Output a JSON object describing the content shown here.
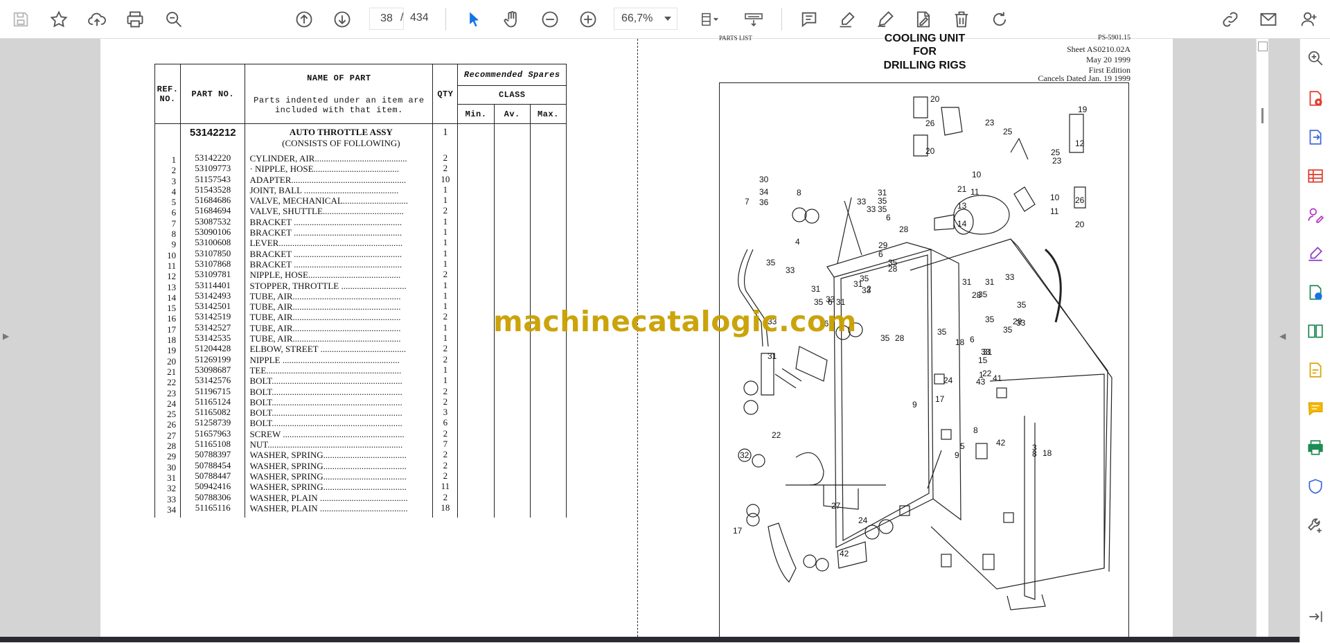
{
  "toolbar": {
    "current_page": "38",
    "page_separator": "/",
    "total_pages": "434",
    "zoom": "66,7%"
  },
  "left_page": {
    "table_headers": {
      "ref": "REF. NO.",
      "part_no": "PART NO.",
      "name": "NAME OF PART",
      "name_note": "Parts indented under an item are included with that item.",
      "qty": "QTY",
      "spares_title": "Recommended Spares",
      "class": "CLASS",
      "min": "Min.",
      "av": "Av.",
      "max": "Max."
    },
    "assembly": {
      "part_no": "53142212",
      "name": "AUTO THROTTLE ASSY",
      "subtitle": "(CONSISTS OF FOLLOWING)",
      "qty": "1"
    },
    "rows": [
      {
        "ref": "1",
        "part": "53142220",
        "name": "CYLINDER, AIR.........................................",
        "qty": "2"
      },
      {
        "ref": "2",
        "part": "53109773",
        "name": "· NIPPLE, HOSE......................................",
        "qty": "2"
      },
      {
        "ref": "3",
        "part": "51157543",
        "name": "ADAPTER...................................................",
        "qty": "10"
      },
      {
        "ref": "4",
        "part": "51543528",
        "name": "JOINT, BALL ..........................................",
        "qty": "1"
      },
      {
        "ref": "5",
        "part": "51684686",
        "name": "VALVE, MECHANICAL.............................",
        "qty": "1"
      },
      {
        "ref": "6",
        "part": "51684694",
        "name": "VALVE, SHUTTLE....................................",
        "qty": "2"
      },
      {
        "ref": "7",
        "part": "53087532",
        "name": "BRACKET ................................................",
        "qty": "1"
      },
      {
        "ref": "8",
        "part": "53090106",
        "name": "BRACKET ................................................",
        "qty": "1"
      },
      {
        "ref": "9",
        "part": "53100608",
        "name": "LEVER.......................................................",
        "qty": "1"
      },
      {
        "ref": "10",
        "part": "53107850",
        "name": "BRACKET ................................................",
        "qty": "1"
      },
      {
        "ref": "11",
        "part": "53107868",
        "name": "BRACKET ................................................",
        "qty": "1"
      },
      {
        "ref": "12",
        "part": "53109781",
        "name": "NIPPLE, HOSE.........................................",
        "qty": "2"
      },
      {
        "ref": "13",
        "part": "53114401",
        "name": "STOPPER, THROTTLE .............................",
        "qty": "1"
      },
      {
        "ref": "14",
        "part": "53142493",
        "name": "TUBE, AIR................................................",
        "qty": "1"
      },
      {
        "ref": "15",
        "part": "53142501",
        "name": "TUBE, AIR................................................",
        "qty": "1"
      },
      {
        "ref": "16",
        "part": "53142519",
        "name": "TUBE, AIR................................................",
        "qty": "2"
      },
      {
        "ref": "17",
        "part": "53142527",
        "name": "TUBE, AIR................................................",
        "qty": "1"
      },
      {
        "ref": "18",
        "part": "53142535",
        "name": "TUBE, AIR................................................",
        "qty": "1"
      },
      {
        "ref": "19",
        "part": "51204428",
        "name": "ELBOW, STREET ......................................",
        "qty": "2"
      },
      {
        "ref": "20",
        "part": "51269199",
        "name": "NIPPLE ....................................................",
        "qty": "2"
      },
      {
        "ref": "21",
        "part": "53098687",
        "name": "TEE............................................................",
        "qty": "1"
      },
      {
        "ref": "22",
        "part": "53142576",
        "name": "BOLT..........................................................",
        "qty": "1"
      },
      {
        "ref": "23",
        "part": "51196715",
        "name": "BOLT..........................................................",
        "qty": "2"
      },
      {
        "ref": "24",
        "part": "51165124",
        "name": "BOLT..........................................................",
        "qty": "2"
      },
      {
        "ref": "25",
        "part": "51165082",
        "name": "BOLT..........................................................",
        "qty": "3"
      },
      {
        "ref": "26",
        "part": "51258739",
        "name": "BOLT..........................................................",
        "qty": "6"
      },
      {
        "ref": "27",
        "part": "51657963",
        "name": "SCREW ......................................................",
        "qty": "2"
      },
      {
        "ref": "28",
        "part": "51165108",
        "name": "NUT............................................................",
        "qty": "7"
      },
      {
        "ref": "29",
        "part": "50788397",
        "name": "WASHER, SPRING.....................................",
        "qty": "2"
      },
      {
        "ref": "30",
        "part": "50788454",
        "name": "WASHER, SPRING.....................................",
        "qty": "2"
      },
      {
        "ref": "31",
        "part": "50788447",
        "name": "WASHER, SPRING.....................................",
        "qty": "2"
      },
      {
        "ref": "32",
        "part": "50942416",
        "name": "WASHER, SPRING.....................................",
        "qty": "11"
      },
      {
        "ref": "33",
        "part": "50788306",
        "name": "WASHER, PLAIN .......................................",
        "qty": "2"
      },
      {
        "ref": "34",
        "part": "51165116",
        "name": "WASHER, PLAIN .......................................",
        "qty": "18"
      }
    ]
  },
  "right_page": {
    "header_left": "PARTS LIST",
    "header_code": "PS-5901.15",
    "sheet": "Sheet AS0210.02A",
    "date": "May 20 1999",
    "edition": "First Edition",
    "cancels": "Cancels Dated  Jan. 19 1999",
    "title_1": "COOLING UNIT",
    "title_2": "FOR",
    "title_3": "DRILLING RIGS",
    "callouts": [
      "20",
      "26",
      "23",
      "25",
      "20",
      "19",
      "12",
      "10",
      "11",
      "25",
      "23",
      "10",
      "11",
      "26",
      "20",
      "30",
      "34",
      "36",
      "7",
      "8",
      "31",
      "33",
      "35",
      "33",
      "35",
      "6",
      "28",
      "21",
      "13",
      "14",
      "29",
      "4",
      "35",
      "6",
      "35",
      "28",
      "33",
      "31",
      "35",
      "33",
      "31",
      "2",
      "31",
      "33",
      "35",
      "6",
      "28",
      "35",
      "31",
      "33",
      "35",
      "29",
      "31",
      "33",
      "35",
      "28",
      "35",
      "6",
      "35",
      "33",
      "31",
      "41",
      "15",
      "1",
      "43",
      "18",
      "22",
      "24",
      "17",
      "35",
      "33",
      "31",
      "16",
      "9",
      "42",
      "9",
      "5",
      "8",
      "3",
      "8",
      "18",
      "22",
      "24",
      "17",
      "27",
      "32",
      "42"
    ]
  },
  "watermark": "machinecatalogic.com"
}
